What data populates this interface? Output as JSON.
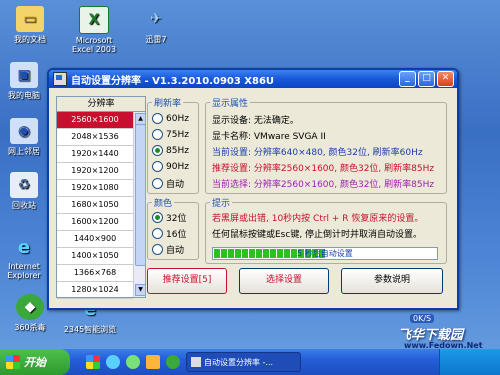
{
  "desktop": {
    "icons": [
      {
        "label": "我的文档"
      },
      {
        "label": "Microsoft Excel 2003"
      },
      {
        "label": "迅雷7"
      },
      {
        "label": "我的电脑"
      },
      {
        "label": "网上邻居"
      },
      {
        "label": "回收站"
      },
      {
        "label": "Internet Explorer"
      },
      {
        "label": "360杀毒"
      },
      {
        "label": "2345智能浏览"
      }
    ]
  },
  "dialog": {
    "title": "自动设置分辨率 - V1.3.2010.0903 X86U",
    "resolution_header": "分辨率",
    "resolutions": [
      "2560×1600",
      "2048×1536",
      "1920×1440",
      "1920×1200",
      "1920×1080",
      "1680×1050",
      "1600×1200",
      "1440×900",
      "1400×1050",
      "1366×768",
      "1280×1024"
    ],
    "selected_resolution": "2560×1600",
    "refresh": {
      "label": "刷新率",
      "options": [
        "60Hz",
        "75Hz",
        "85Hz",
        "90Hz",
        "自动"
      ],
      "selected": "85Hz"
    },
    "color": {
      "label": "颜色",
      "options": [
        "32位",
        "16位",
        "自动"
      ],
      "selected": "32位"
    },
    "props": {
      "label": "显示属性",
      "device": "显示设备: 无法确定。",
      "card": "显卡名称: VMware SVGA II",
      "current": "当前设置: 分辨率640×480, 颜色32位, 刷新率60Hz",
      "recommended": "推荐设置: 分辨率2560×1600, 颜色32位, 刷新率85Hz",
      "selected": "当前选择: 分辨率2560×1600, 颜色32位, 刷新率85Hz"
    },
    "hint": {
      "label": "提示",
      "line1": "若黑屏或出错, 10秒内按 Ctrl + R 恢复原来的设置。",
      "line2": "任何鼠标按键或Esc键, 停止倒计时并取消自动设置。",
      "progress_text": "5 秒后自动设置",
      "progress": 0.5
    },
    "buttons": {
      "recommend": "推荐设置[5]",
      "select": "选择设置",
      "help": "参数说明"
    }
  },
  "taskbar": {
    "start": "开始",
    "task": "自动设置分辨率 -..."
  },
  "watermark": {
    "brand": "飞华下载园",
    "url": "www.Fedown.Net",
    "badge": "0K/S"
  },
  "colors": {
    "selected_res": "#c8102e",
    "accent_blue": "#1a3ea8",
    "accent_red": "#c8102e",
    "accent_purple": "#a020b0",
    "progress": "#2ec020"
  }
}
